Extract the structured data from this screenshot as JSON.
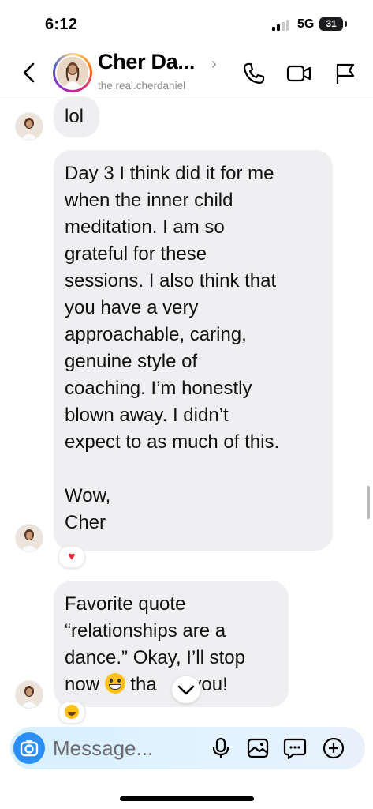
{
  "status_bar": {
    "time": "6:12",
    "network": "5G",
    "battery": "31"
  },
  "header": {
    "contact_name": "Cher Da...",
    "handle": "the.real.cherdaniel",
    "icons": {
      "back": "back-chevron-icon",
      "call": "phone-icon",
      "video": "video-camera-icon",
      "report": "flag-icon"
    }
  },
  "messages": [
    {
      "lines": [
        "lol"
      ]
    },
    {
      "lines": [
        "Day 3 I think did it for me",
        "when the inner child",
        "meditation. I am so",
        "grateful for these",
        "sessions. I also think that",
        "you have a very",
        "approachable, caring,",
        "genuine style of",
        "coaching. I’m honestly",
        "blown away. I didn’t",
        "expect to as much of this.",
        "",
        "Wow,",
        "Cher"
      ],
      "reaction": "♥"
    },
    {
      "lines": [
        "Favorite quote",
        "“relationships are a",
        "dance.” Okay, I’ll stop"
      ],
      "last_line_before": "now ",
      "last_line_middle": " tha",
      "last_line_after": " you!",
      "reaction_icon": "laughing-emoji-icon"
    }
  ],
  "composer": {
    "placeholder": "Message...",
    "icons": [
      "camera-icon",
      "microphone-icon",
      "gallery-icon",
      "sticker-icon",
      "add-icon"
    ]
  },
  "colors": {
    "accent": "#2b8ef5",
    "bubble": "#efeff1",
    "heart": "#e0263c"
  }
}
